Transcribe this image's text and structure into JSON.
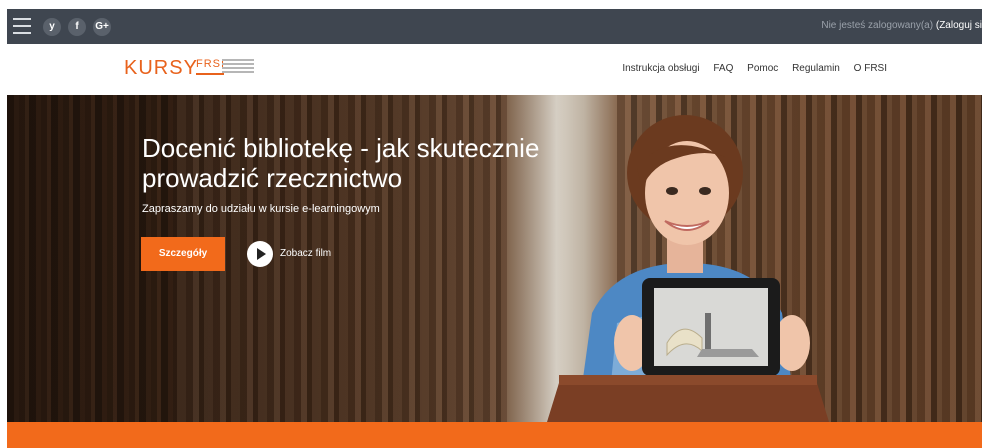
{
  "topbar": {
    "social": [
      {
        "icon": "twitter-icon",
        "glyph": "y"
      },
      {
        "icon": "facebook-icon",
        "glyph": "f"
      },
      {
        "icon": "google-plus-icon",
        "glyph": "G+"
      }
    ],
    "login_text": "Nie jesteś zalogowany(a) ",
    "login_link": "(Zaloguj si"
  },
  "header": {
    "logo_main": "KURSY",
    "logo_frsi": "FRSI",
    "nav": [
      "Instrukcja obsługi",
      "FAQ",
      "Pomoc",
      "Regulamin",
      "O FRSI"
    ]
  },
  "hero": {
    "title": "Docenić bibliotekę - jak skutecznie prowadzić rzecznictwo",
    "subtitle": "Zapraszamy do udziału w kursie e-learningowym",
    "details_button": "Szczegóły",
    "film_label": "Zobacz film"
  },
  "colors": {
    "accent": "#f26a1b",
    "topbar": "#3f4650"
  }
}
